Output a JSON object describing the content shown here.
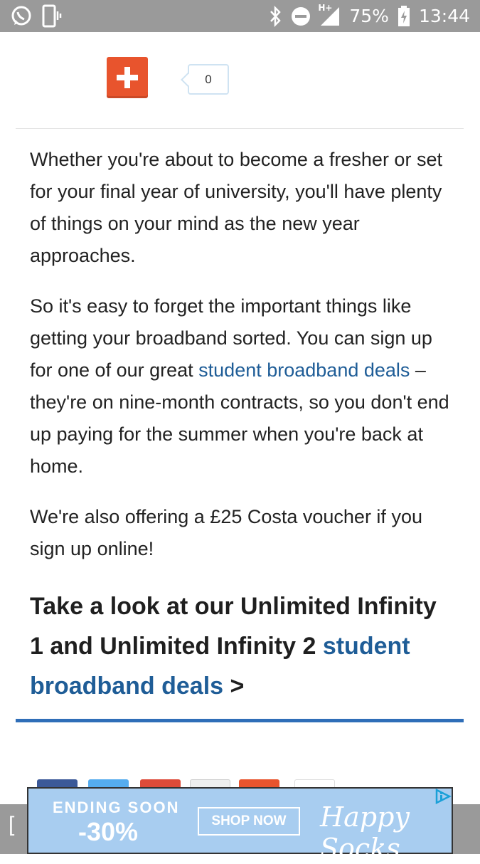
{
  "status_bar": {
    "battery_text": "75%",
    "time": "13:44",
    "network_label": "H+"
  },
  "share": {
    "count": "0",
    "plus_color": "#e8542d"
  },
  "article": {
    "paragraphs": [
      {
        "text": "Whether you're about to become a fresher or set for your final year of university, you'll have plenty of things on your mind as the new year approaches."
      },
      {
        "text_before": "So it's easy to forget the important things like getting your broadband sorted. You can sign up for one of our great ",
        "link": "student broadband deals",
        "text_after": " – they're on nine-month contracts, so you don't end up paying for the summer when you're back at home."
      },
      {
        "text": "We're also offering a £25 Costa voucher if you sign up online!"
      }
    ],
    "cta": {
      "text": "Take a look at our Unlimited Infinity 1 and Unlimited Infinity 2 ",
      "link": "student broadband deals",
      "arrow": ">"
    },
    "link_color": "#1f5d97"
  },
  "ad": {
    "ending_label": "ENDING SOON",
    "discount": "-30%",
    "button_label": "SHOP NOW",
    "brand": "Happy Socks",
    "background": "#a8cdf0"
  }
}
